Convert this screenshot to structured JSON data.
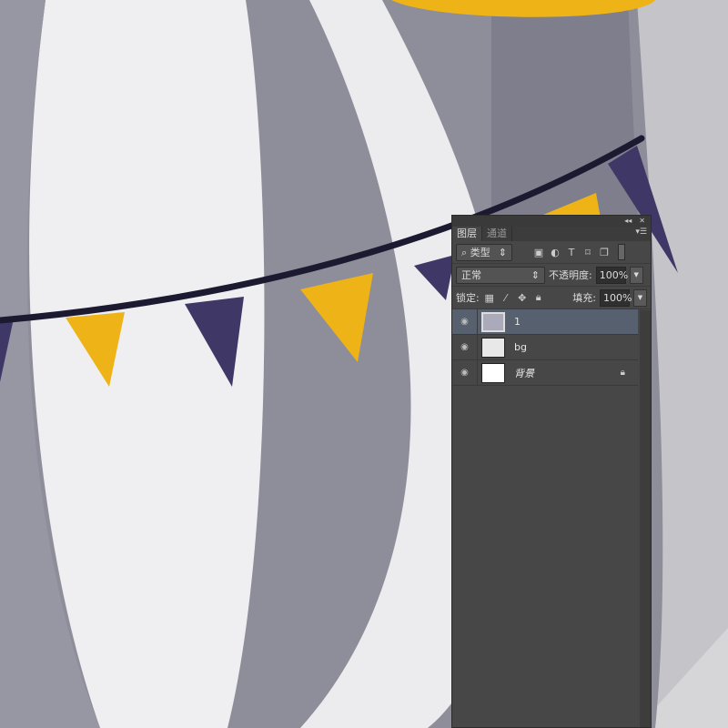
{
  "panel": {
    "collapse_icon": "double-chevron-left-icon",
    "close_icon": "close-icon",
    "tabs": [
      {
        "label": "图层",
        "active": true
      },
      {
        "label": "通道",
        "active": false
      }
    ],
    "filter": {
      "label": "类型",
      "icon": "search-icon"
    },
    "filter_icons": [
      "image-filter-icon",
      "adjustment-filter-icon",
      "text-filter-icon",
      "shape-filter-icon",
      "smart-object-filter-icon"
    ],
    "blend_mode": "正常",
    "opacity_label": "不透明度:",
    "opacity_value": "100%",
    "lock_label": "锁定:",
    "fill_label": "填充:",
    "fill_value": "100%",
    "layers": [
      {
        "name": "1",
        "selected": true,
        "visible": true
      },
      {
        "name": "bg",
        "selected": false,
        "visible": true
      },
      {
        "name": "背景",
        "selected": false,
        "visible": true,
        "locked": true
      }
    ]
  },
  "colors": {
    "accent_yellow": "#eeb317",
    "flag_purple": "#3f3866",
    "string": "#1b1a30",
    "selection": "#56606e"
  }
}
